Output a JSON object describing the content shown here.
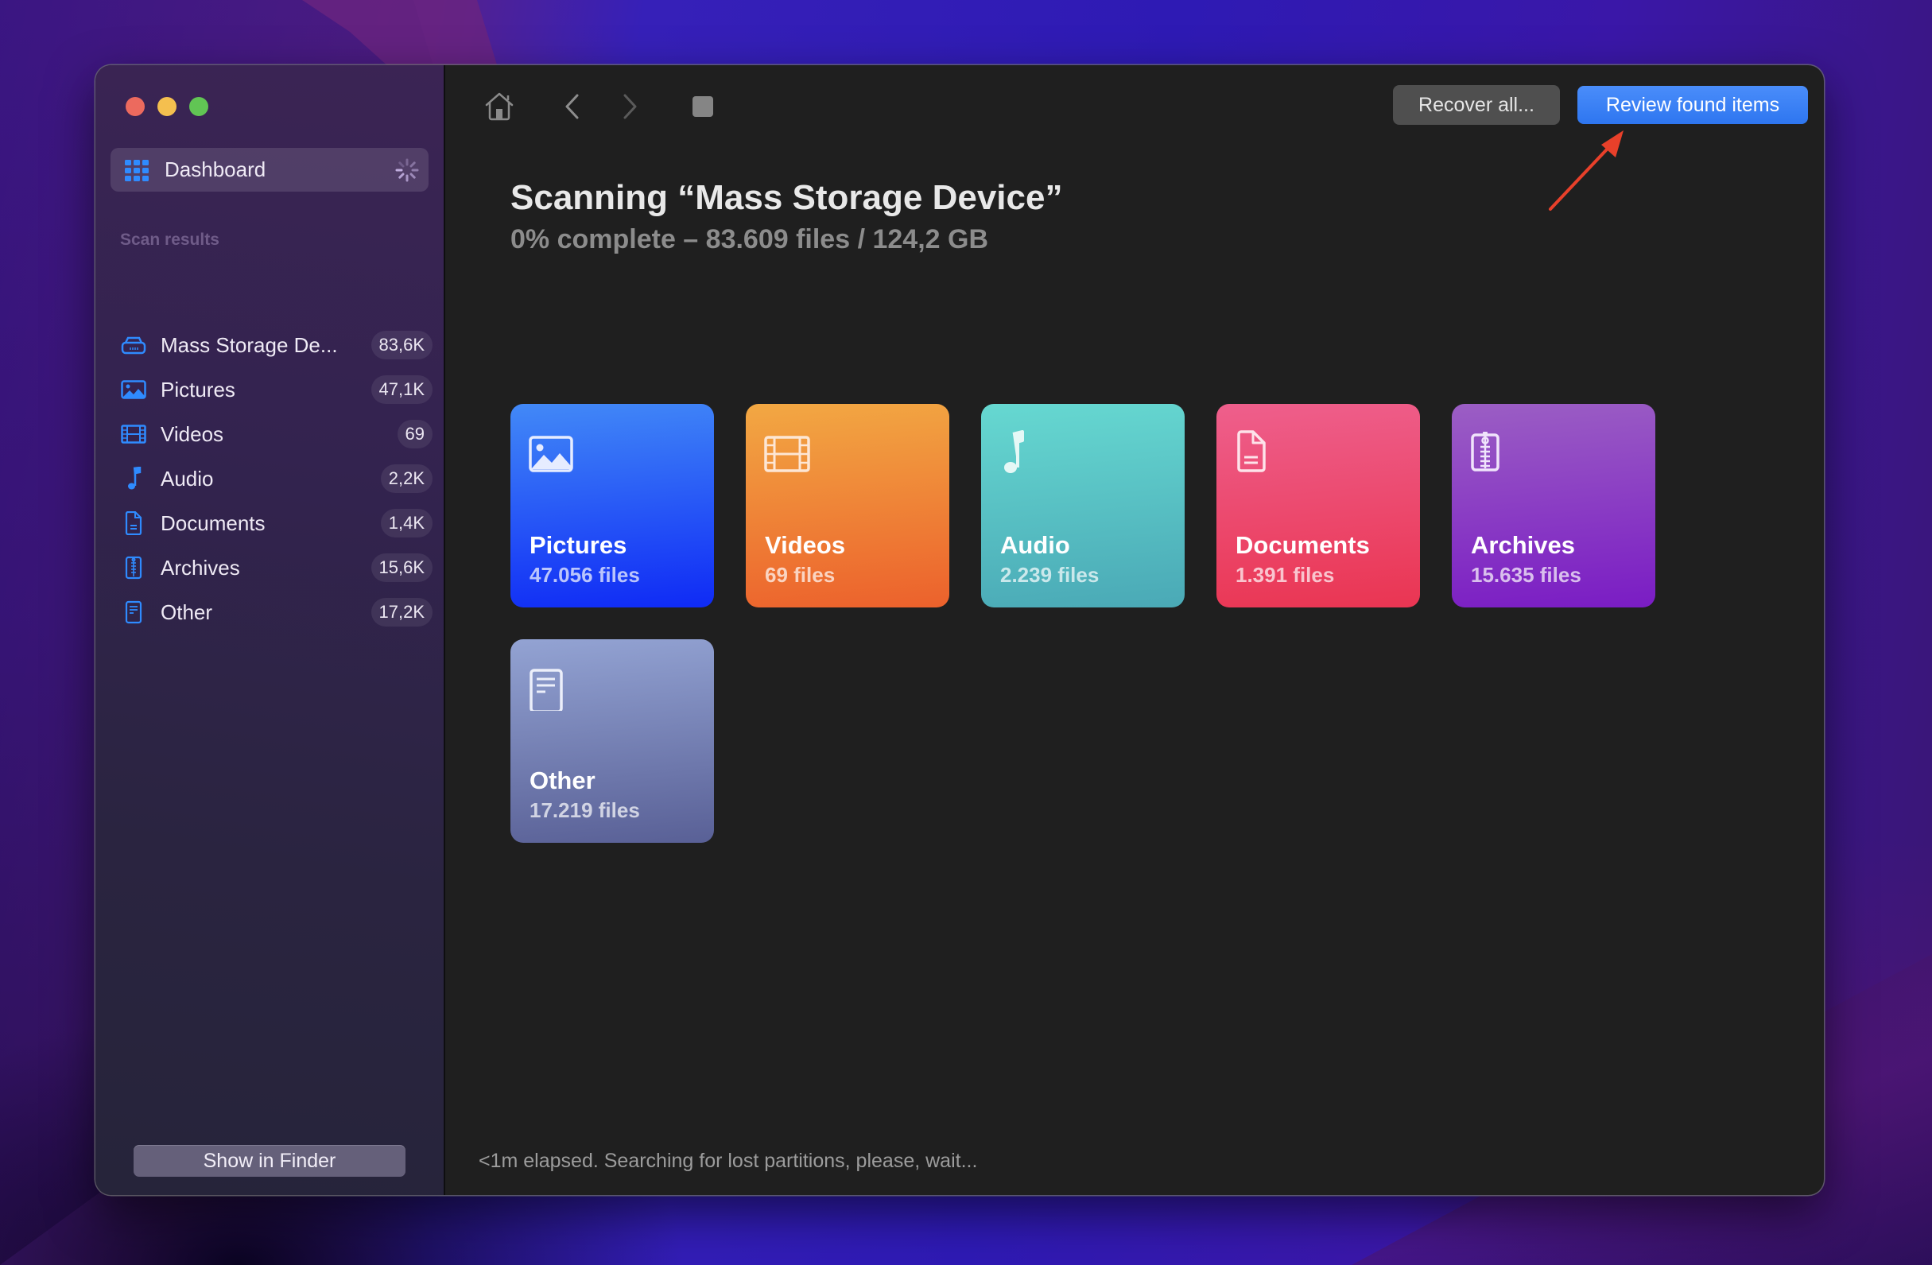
{
  "window": {
    "traffic_lights": [
      "close",
      "minimize",
      "zoom"
    ]
  },
  "sidebar": {
    "dashboard": {
      "label": "Dashboard",
      "icon": "grid-icon",
      "status": "loading-spinner"
    },
    "section_label": "Scan results",
    "items": [
      {
        "label": "Mass Storage De...",
        "full_label": "Mass Storage Device",
        "count": "83,6K",
        "icon": "drive-icon"
      },
      {
        "label": "Pictures",
        "count": "47,1K",
        "icon": "picture-icon"
      },
      {
        "label": "Videos",
        "count": "69",
        "icon": "film-icon"
      },
      {
        "label": "Audio",
        "count": "2,2K",
        "icon": "music-note-icon"
      },
      {
        "label": "Documents",
        "count": "1,4K",
        "icon": "document-icon"
      },
      {
        "label": "Archives",
        "count": "15,6K",
        "icon": "archive-zip-icon"
      },
      {
        "label": "Other",
        "count": "17,2K",
        "icon": "other-file-icon"
      }
    ],
    "show_in_finder_label": "Show in Finder"
  },
  "toolbar": {
    "home_icon": "home-icon",
    "back_icon": "chevron-left-icon",
    "forward_icon": "chevron-right-icon",
    "stop_icon": "stop-icon",
    "recover_all_label": "Recover all...",
    "review_label": "Review found items"
  },
  "main": {
    "title": "Scanning “Mass Storage Device”",
    "subtitle": "0% complete – 83.609 files / 124,2 GB",
    "progress_percent": 0,
    "cards": [
      {
        "name": "Pictures",
        "count": "47.056 files",
        "icon": "picture-icon",
        "color_top": "#4289f7",
        "color_bottom": "#0f2af5"
      },
      {
        "name": "Videos",
        "count": "69 files",
        "icon": "film-icon",
        "color_top": "#f2a843",
        "color_bottom": "#ec612c"
      },
      {
        "name": "Audio",
        "count": "2.239 files",
        "icon": "music-note-icon",
        "color_top": "#66d8d1",
        "color_bottom": "#4aa9b6"
      },
      {
        "name": "Documents",
        "count": "1.391 files",
        "icon": "document-icon",
        "color_top": "#ee5f8c",
        "color_bottom": "#ea3552"
      },
      {
        "name": "Archives",
        "count": "15.635 files",
        "icon": "archive-zip-icon",
        "color_top": "#9b5ec4",
        "color_bottom": "#7a1cc4"
      },
      {
        "name": "Other",
        "count": "17.219 files",
        "icon": "other-file-icon",
        "color_top": "#93a3d3",
        "color_bottom": "#596096"
      }
    ],
    "status_text": "<1m elapsed. Searching for lost partitions, please, wait..."
  },
  "colors": {
    "accent": "#2f7cf6",
    "annotation_arrow": "#e8402a",
    "sidebar_icon": "#2f8bff"
  }
}
